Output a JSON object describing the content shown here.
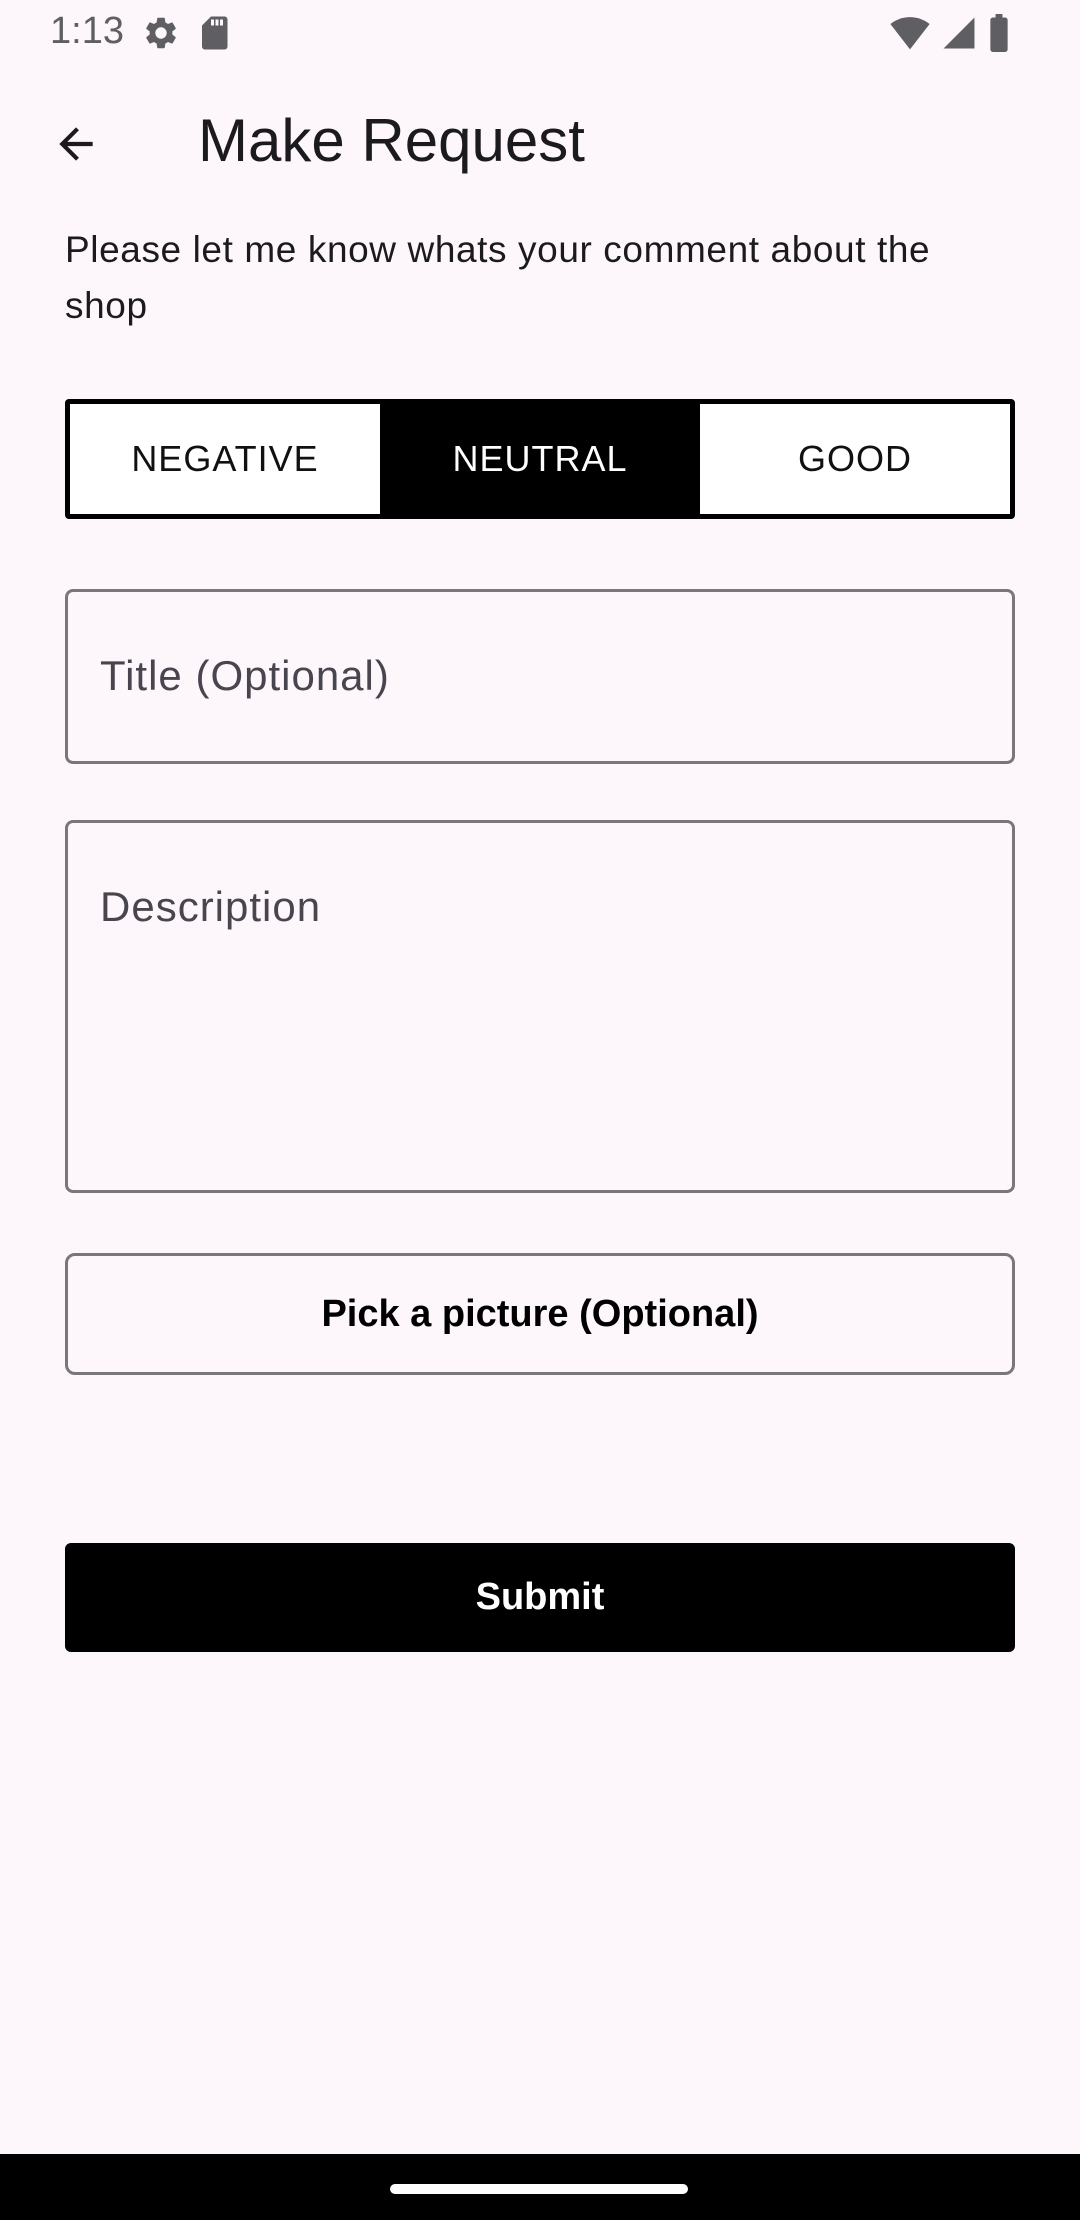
{
  "status_bar": {
    "time": "1:13",
    "left_icons": [
      "settings-icon",
      "sd-card-icon"
    ],
    "right_icons": [
      "wifi-icon",
      "signal-icon",
      "battery-icon"
    ]
  },
  "app_bar": {
    "title": "Make Request",
    "back_icon": "arrow-back-icon"
  },
  "prompt": "Please let me know whats your comment about the shop",
  "rating": {
    "options": [
      "NEGATIVE",
      "NEUTRAL",
      "GOOD"
    ],
    "selected": "NEUTRAL"
  },
  "form": {
    "title_placeholder": "Title (Optional)",
    "description_placeholder": "Description",
    "pick_picture_label": "Pick a picture (Optional)",
    "submit_label": "Submit"
  },
  "colors": {
    "background": "#fdf7fb",
    "accent": "#000000",
    "outline": "#79767c"
  }
}
